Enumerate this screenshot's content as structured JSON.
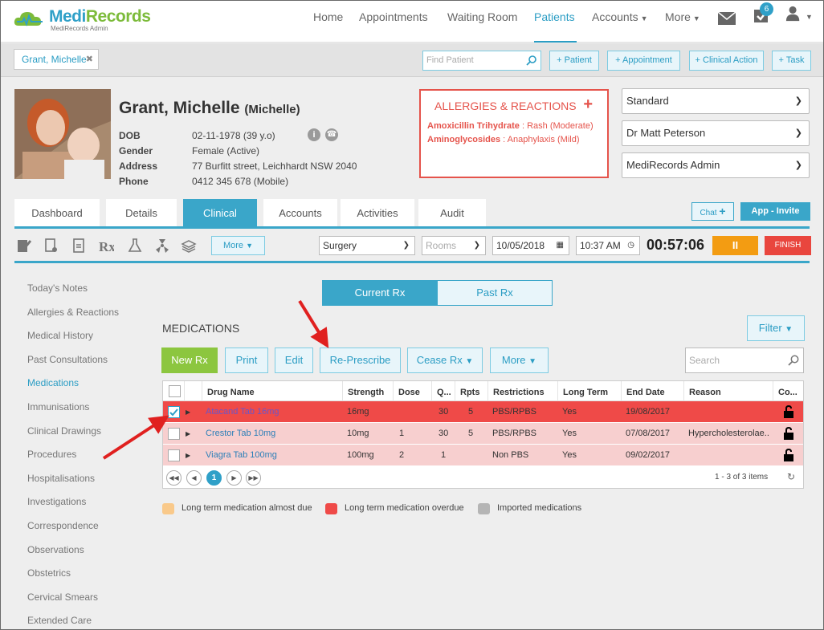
{
  "header": {
    "logo_main": "Medi",
    "logo_accent": "Records",
    "logo_sub": "MediRecords Admin",
    "nav": [
      "Home",
      "Appointments",
      "Waiting Room",
      "Patients",
      "Accounts",
      "More"
    ],
    "active_nav": "Patients",
    "tasks_badge": "6"
  },
  "subbar": {
    "patient_tab": "Grant, Michelle",
    "find_placeholder": "Find Patient",
    "buttons": [
      "+ Patient",
      "+ Appointment",
      "+ Clinical Action",
      "+ Task"
    ]
  },
  "patient": {
    "name": "Grant, Michelle",
    "preferred": "(Michelle)",
    "fields": [
      {
        "label": "DOB",
        "value": "02-11-1978 (39 y.o)"
      },
      {
        "label": "Gender",
        "value": "Female (Active)"
      },
      {
        "label": "Address",
        "value": "77 Burfitt street, Leichhardt NSW 2040"
      },
      {
        "label": "Phone",
        "value": "0412 345 678 (Mobile)"
      }
    ]
  },
  "allergies": {
    "title": "ALLERGIES & REACTIONS",
    "items": [
      {
        "drug": "Amoxicillin Trihydrate",
        "reaction": " : Rash (Moderate)"
      },
      {
        "drug": "Aminoglycosides",
        "reaction": " : Anaphylaxis (Mild)"
      }
    ]
  },
  "selects": [
    "Standard",
    "Dr Matt Peterson",
    "MediRecords Admin"
  ],
  "tabs": [
    "Dashboard",
    "Details",
    "Clinical",
    "Accounts",
    "Activities",
    "Audit"
  ],
  "active_tab": "Clinical",
  "chat_label": "Chat",
  "invite_label": "App - Invite",
  "toolbar": {
    "more_label": "More",
    "location": "Surgery",
    "rooms_placeholder": "Rooms",
    "date": "10/05/2018",
    "time": "10:37 AM",
    "timer": "00:57:06",
    "pause_label": "II",
    "finish_label": "FINISH"
  },
  "left_menu": [
    "Today's Notes",
    "Allergies & Reactions",
    "Medical History",
    "Past Consultations",
    "Medications",
    "Immunisations",
    "Clinical Drawings",
    "Procedures",
    "Hospitalisations",
    "Investigations",
    "Correspondence",
    "Observations",
    "Obstetrics",
    "Cervical Smears",
    "Extended Care"
  ],
  "active_menu": "Medications",
  "rx_toggle": {
    "current": "Current Rx",
    "past": "Past Rx"
  },
  "section_title": "MEDICATIONS",
  "filter_label": "Filter",
  "actions": {
    "new_rx": "New Rx",
    "print": "Print",
    "edit": "Edit",
    "represcribe": "Re-Prescribe",
    "cease": "Cease Rx",
    "more": "More"
  },
  "search_placeholder": "Search",
  "table": {
    "columns": [
      "Drug Name",
      "Strength",
      "Dose",
      "Q...",
      "Rpts",
      "Restrictions",
      "Long Term",
      "End Date",
      "Reason",
      "Co..."
    ],
    "rows": [
      {
        "drug": "Atacand Tab 16mg",
        "strength": "16mg",
        "dose": "",
        "qty": "30",
        "rpts": "5",
        "restrictions": "PBS/RPBS",
        "long_term": "Yes",
        "end_date": "19/08/2017",
        "reason": "",
        "checked": true
      },
      {
        "drug": "Crestor Tab 10mg",
        "strength": "10mg",
        "dose": "1",
        "qty": "30",
        "rpts": "5",
        "restrictions": "PBS/RPBS",
        "long_term": "Yes",
        "end_date": "07/08/2017",
        "reason": "Hypercholesterolae...",
        "checked": false
      },
      {
        "drug": "Viagra Tab 100mg",
        "strength": "100mg",
        "dose": "2",
        "qty": "1",
        "rpts": "",
        "restrictions": "Non PBS",
        "long_term": "Yes",
        "end_date": "09/02/2017",
        "reason": "",
        "checked": false
      }
    ],
    "current_page": "1",
    "page_info": "1 - 3 of 3 items"
  },
  "legend": [
    {
      "label": "Long term medication almost due",
      "color": "#f9c98a"
    },
    {
      "label": "Long term medication overdue",
      "color": "#ef4a48"
    },
    {
      "label": "Imported medications",
      "color": "#b5b5b5"
    }
  ],
  "colors": {
    "accent": "#2fa0c8",
    "overdue_row": "#ef4a48",
    "pink_row": "#f7cfcf",
    "green": "#8cc63f",
    "orange": "#f39c12"
  }
}
